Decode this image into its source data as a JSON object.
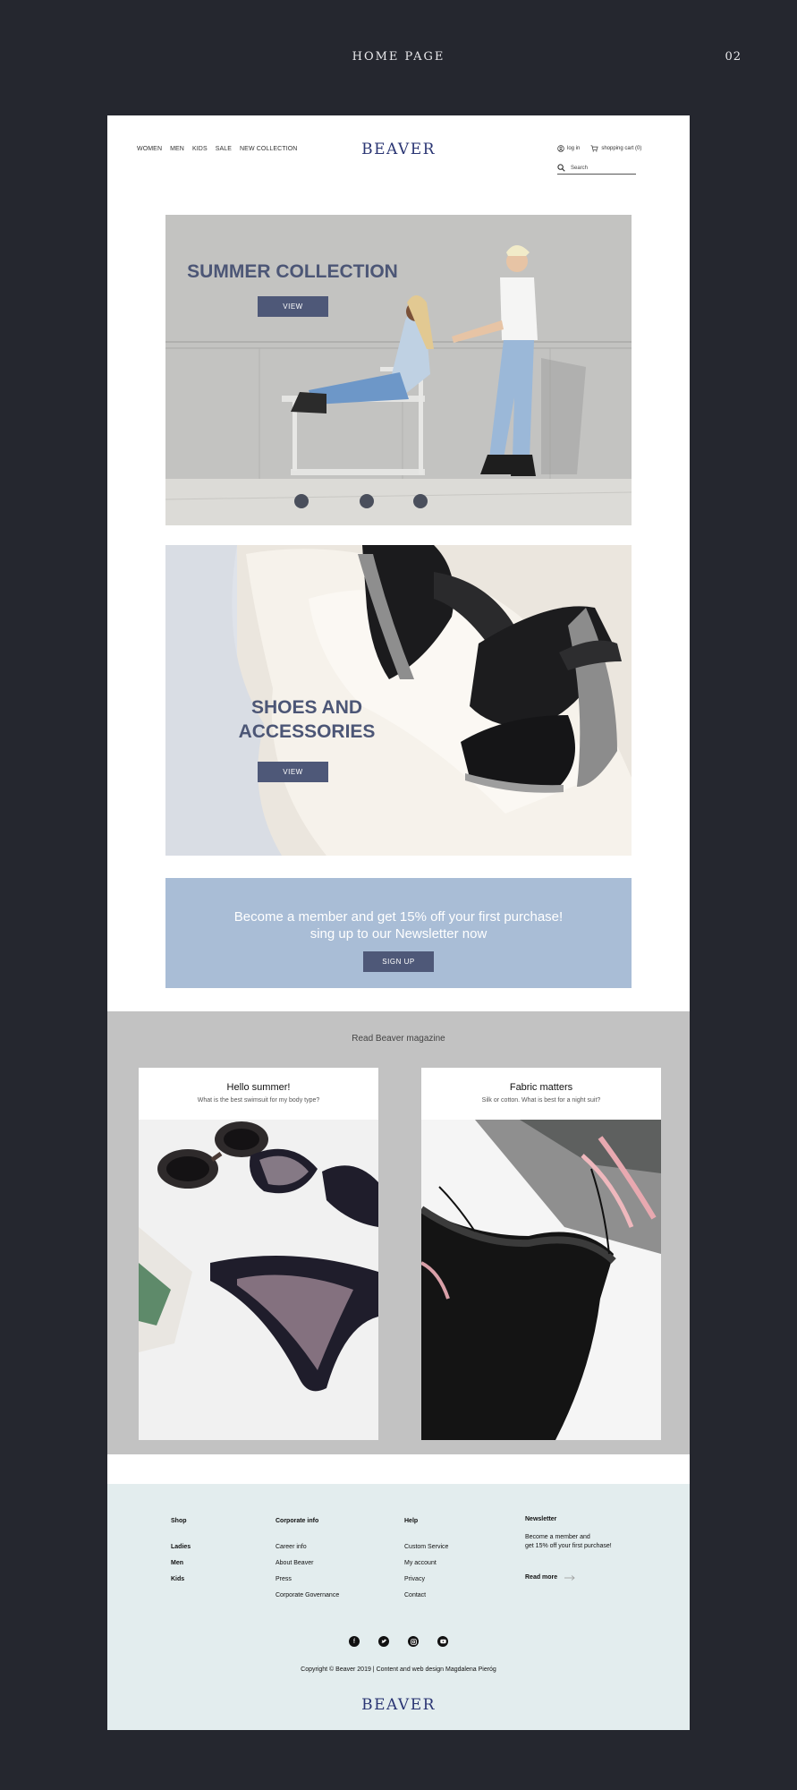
{
  "page": {
    "title": "HOME PAGE",
    "number": "02"
  },
  "header": {
    "nav": [
      "WOMEN",
      "MEN",
      "KIDS",
      "SALE",
      "NEW COLLECTION"
    ],
    "logo": "BEAVER",
    "login": "log in",
    "cart": "shopping cart (0)",
    "search_placeholder": "Search"
  },
  "banners": [
    {
      "title": "SUMMER COLLECTION",
      "button": "VIEW"
    },
    {
      "title": "SHOES AND ACCESSORIES",
      "button": "VIEW"
    }
  ],
  "promo": {
    "line1": "Become a member and  get 15% off  your first purchase!",
    "line2": "sing up to our Newsletter now",
    "button": "SIGN UP"
  },
  "magazine": {
    "title": "Read Beaver magazine",
    "cards": [
      {
        "title": "Hello summer!",
        "subtitle": "What is the best swimsuit for my body type?"
      },
      {
        "title": "Fabric matters",
        "subtitle": "Silk or cotton. What is best for a night suit?"
      }
    ]
  },
  "footer": {
    "shop": {
      "head": "Shop",
      "items": [
        "Ladies",
        "Men",
        "Kids"
      ]
    },
    "corporate": {
      "head": "Corporate info",
      "items": [
        "Career info",
        "About Beaver",
        "Press",
        "Corporate Governance"
      ]
    },
    "help": {
      "head": "Help",
      "items": [
        "Custom Service",
        "My account",
        "Privacy",
        "Contact"
      ]
    },
    "newsletter": {
      "head": "Newsletter",
      "line1": "Become a member and",
      "line2": "get 15% off your first purchase!",
      "more": "Read more"
    },
    "socials": [
      "facebook-icon",
      "twitter-icon",
      "instagram-icon",
      "youtube-icon"
    ],
    "copyright": "Copyright © Beaver 2019 | Content and web design Magdalena Pieróg",
    "logo": "BEAVER"
  },
  "colors": {
    "background": "#25272f",
    "brand": "#2a3573",
    "button": "#4e5878",
    "promo": "#a9bdd6",
    "magazine_bg": "#c2c2c2",
    "footer_bg": "#e3edee"
  }
}
